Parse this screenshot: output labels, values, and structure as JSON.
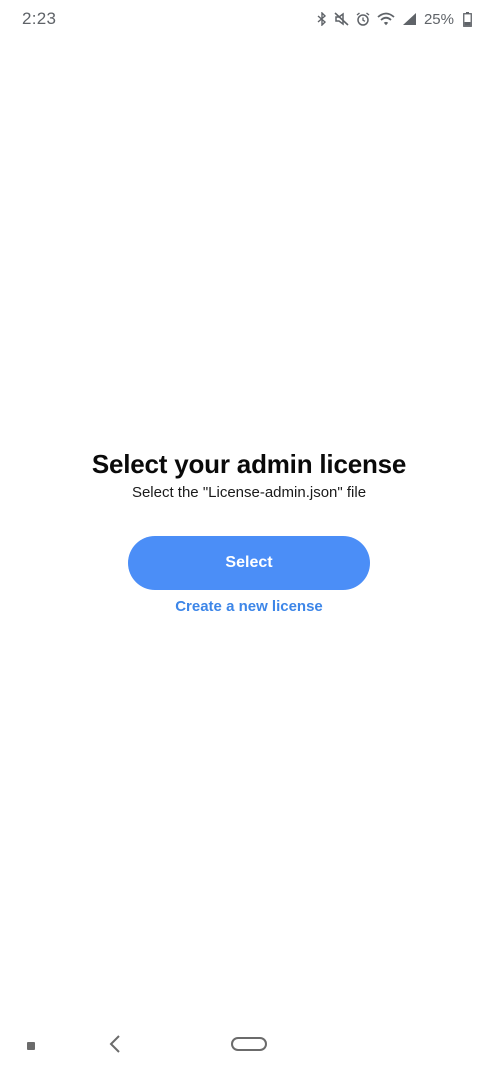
{
  "status_bar": {
    "time": "2:23",
    "battery_percent": "25%",
    "icons": [
      "bluetooth-icon",
      "mute-icon",
      "alarm-icon",
      "wifi-icon",
      "signal-icon",
      "battery-icon"
    ]
  },
  "main": {
    "title": "Select your admin license",
    "subtitle": "Select the \"License-admin.json\" file",
    "select_button_label": "Select",
    "create_link_label": "Create a new license"
  },
  "nav_bar": {
    "icons": [
      "recents-icon",
      "back-icon",
      "home-icon"
    ]
  },
  "colors": {
    "accent": "#4b8ef7",
    "link": "#3d86e8",
    "background": "#ffffff",
    "status_icons": "#5f6368"
  }
}
